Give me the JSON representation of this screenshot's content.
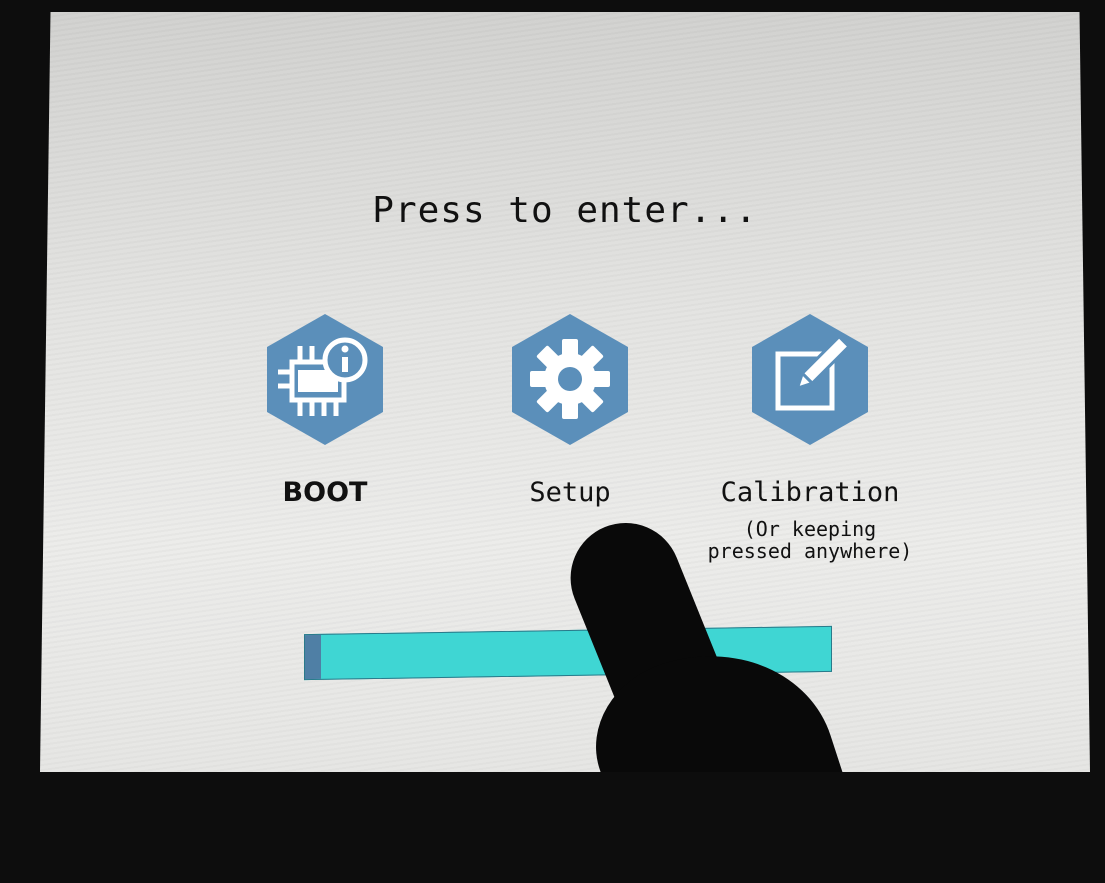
{
  "prompt": {
    "title": "Press to enter..."
  },
  "menu": {
    "items": [
      {
        "label": "BOOT",
        "icon": "chip-info-icon"
      },
      {
        "label": "Setup",
        "icon": "gear-icon"
      },
      {
        "label": "Calibration",
        "icon": "edit-pencil-icon",
        "note_line1": "(Or keeping",
        "note_line2": "pressed anywhere)"
      }
    ]
  },
  "progress": {
    "fraction": 0.03
  },
  "colors": {
    "accent": "#5b8fba",
    "progress_bar": "#3fd6d3",
    "progress_fill": "#4f7fa5",
    "background": "#e6e6e4"
  }
}
